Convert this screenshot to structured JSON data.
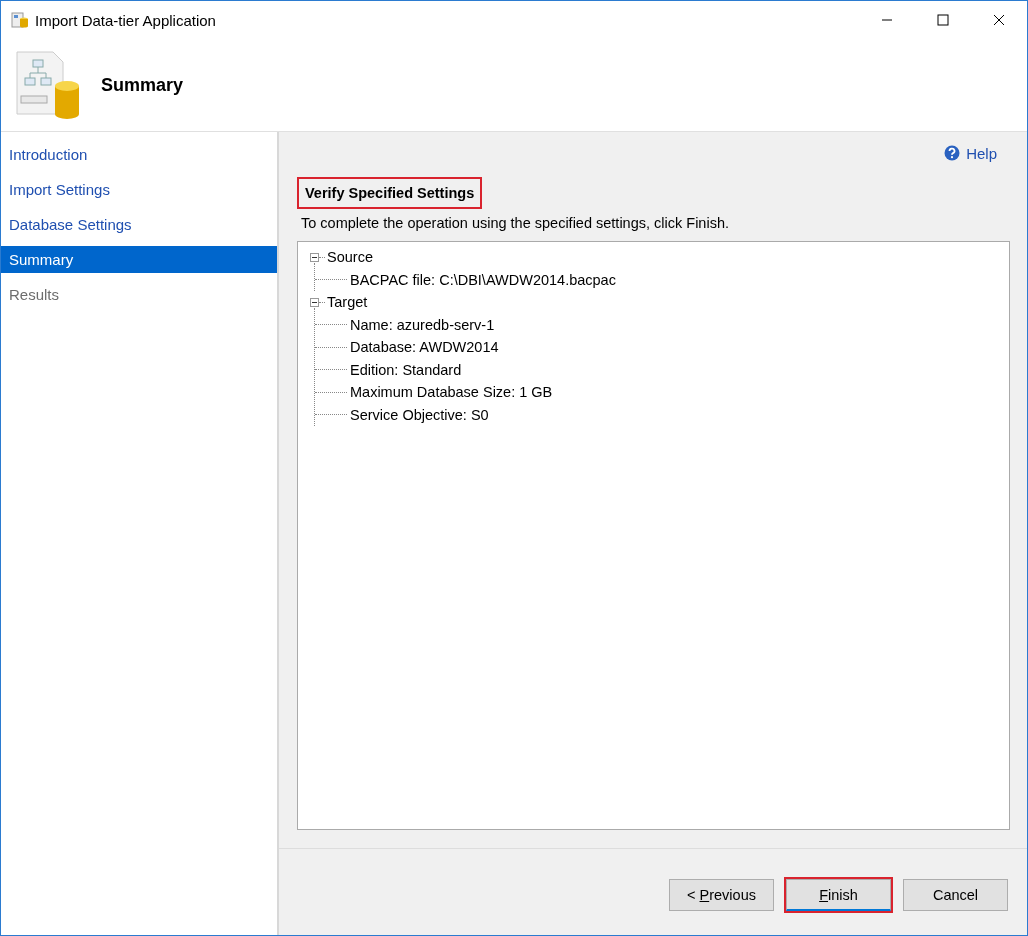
{
  "window": {
    "title": "Import Data-tier Application"
  },
  "header": {
    "title": "Summary"
  },
  "sidebar": {
    "items": [
      {
        "label": "Introduction",
        "selected": false,
        "disabled": false
      },
      {
        "label": "Import Settings",
        "selected": false,
        "disabled": false
      },
      {
        "label": "Database Settings",
        "selected": false,
        "disabled": false
      },
      {
        "label": "Summary",
        "selected": true,
        "disabled": false
      },
      {
        "label": "Results",
        "selected": false,
        "disabled": true
      }
    ]
  },
  "help": {
    "label": "Help"
  },
  "section": {
    "heading": "Verify Specified Settings",
    "highlighted": true,
    "instruction": "To complete the operation using the specified settings, click Finish."
  },
  "tree": [
    {
      "label": "Source",
      "expanded": true,
      "children": [
        {
          "label": "BACPAC file: C:\\DBI\\AWDW2014.bacpac"
        }
      ]
    },
    {
      "label": "Target",
      "expanded": true,
      "children": [
        {
          "label": "Name: azuredb-serv-1"
        },
        {
          "label": "Database: AWDW2014"
        },
        {
          "label": "Edition: Standard"
        },
        {
          "label": "Maximum Database Size: 1 GB"
        },
        {
          "label": "Service Objective: S0"
        }
      ]
    }
  ],
  "buttons": [
    {
      "prefix": "< ",
      "key": "P",
      "rest": "revious",
      "default": false,
      "highlighted": false
    },
    {
      "key": "F",
      "rest": "inish",
      "default": true,
      "highlighted": true
    },
    {
      "rest": "Cancel",
      "default": false,
      "highlighted": false
    }
  ]
}
